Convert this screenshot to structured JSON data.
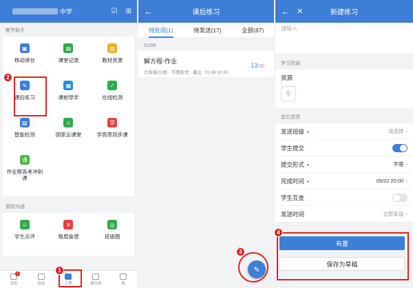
{
  "panel1": {
    "school_suffix": "中学",
    "header_icons": [
      "checklist-icon",
      "scan-icon"
    ],
    "section_teaching": "教学助手",
    "teaching_items": [
      {
        "label": "移动讲台",
        "color": "#3d7ed6",
        "glyph": "▣"
      },
      {
        "label": "课堂记录",
        "color": "#2eaa4a",
        "glyph": "▤"
      },
      {
        "label": "教材资源",
        "color": "#f0b020",
        "glyph": "▥"
      },
      {
        "label": "课后练习",
        "color": "#3d7ed6",
        "glyph": "✎"
      },
      {
        "label": "课前导学",
        "color": "#2a8fd6",
        "glyph": "▦"
      },
      {
        "label": "在线检测",
        "color": "#2eaa4a",
        "glyph": "✓"
      },
      {
        "label": "智能检测",
        "color": "#3d7ed6",
        "glyph": "▧"
      },
      {
        "label": "国家云课堂",
        "color": "#2eaa4a",
        "glyph": "☺"
      },
      {
        "label": "学而思同步课",
        "color": "#e64040",
        "glyph": "学"
      },
      {
        "label": "作业帮高考冲刺课",
        "color": "#4ab840",
        "glyph": "课"
      }
    ],
    "section_home_school": "家校沟通",
    "home_school_items": [
      {
        "label": "学生点评",
        "color": "#2eaa4a",
        "glyph": "☺"
      },
      {
        "label": "每周食谱",
        "color": "#e64040",
        "glyph": "✕"
      },
      {
        "label": "班级圈",
        "color": "#2eaa4a",
        "glyph": "◎"
      }
    ],
    "nav": [
      {
        "label": "消息",
        "badge": "1"
      },
      {
        "label": "班级",
        "badge": ""
      },
      {
        "label": "工作",
        "badge": ""
      },
      {
        "label": "通讯录",
        "badge": ""
      },
      {
        "label": "我",
        "badge": ""
      }
    ]
  },
  "panel2": {
    "title": "课后练习",
    "tabs": [
      "待批阅(1)",
      "待发送(17)",
      "全部(87)"
    ],
    "date": "01/06",
    "homework": {
      "title": "解方程-作业",
      "meta": "六年级(1)班 · 不限形式 · 截止: 01-08 10:00",
      "done": "13",
      "total": "/30"
    }
  },
  "panel3": {
    "title": "新建练习",
    "input_placeholder": "请输入",
    "section_resources": "学习资源",
    "resources_label": "资源",
    "section_other": "其它选项",
    "rows": [
      {
        "label": "发送班级",
        "required": "•",
        "value": "请选择"
      },
      {
        "label": "学生提交",
        "required": "",
        "value": ""
      },
      {
        "label": "提交形式",
        "required": "•",
        "value": "不限"
      },
      {
        "label": "完成时间",
        "required": "•",
        "value": "05/22 20:00"
      },
      {
        "label": "学生互查",
        "required": "",
        "value": ""
      },
      {
        "label": "发送时间",
        "required": "",
        "value": "立即发送"
      }
    ],
    "submit_toggle": true,
    "peer_review_toggle": false,
    "publish_button": "布置",
    "draft_button": "保存为草稿"
  },
  "callouts": [
    "1",
    "2",
    "3",
    "4"
  ]
}
